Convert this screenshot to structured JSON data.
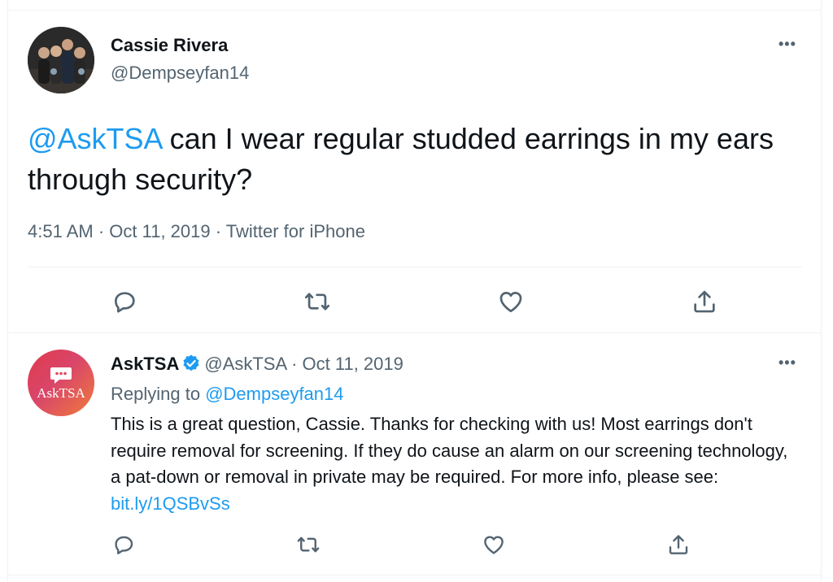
{
  "main_tweet": {
    "author_name": "Cassie Rivera",
    "author_handle": "@Dempseyfan14",
    "more_label": "•••",
    "text_mention": "@AskTSA",
    "text_body": " can I wear regular studded earrings in my ears through security?",
    "time": "4:51 AM",
    "sep1": " · ",
    "date": "Oct 11, 2019",
    "sep2": " · ",
    "source": "Twitter for iPhone",
    "actions": [
      "reply-icon",
      "retweet-icon",
      "like-icon",
      "share-icon"
    ]
  },
  "reply_tweet": {
    "avatar_text": "AskTSA",
    "author_name": "AskTSA",
    "author_handle": "@AskTSA",
    "sep": " · ",
    "date": "Oct 11, 2019",
    "more_label": "•••",
    "replying_prefix": "Replying to ",
    "replying_handle": "@Dempseyfan14",
    "text_body": "This is a great question, Cassie. Thanks for checking with us! Most earrings don't require removal for screening. If they do cause an alarm on our screening technology, a pat-down or removal in private may be required. For more info, please see: ",
    "text_link": "bit.ly/1QSBvSs",
    "actions": [
      "reply-icon",
      "retweet-icon",
      "like-icon",
      "share-icon"
    ]
  },
  "colors": {
    "link": "#1d9bf0",
    "secondary_text": "#536471",
    "primary_text": "#0f1419",
    "verified": "#1d9bf0",
    "askTSA_gradient": [
      "#e03a4b",
      "#ef7b3b"
    ]
  }
}
